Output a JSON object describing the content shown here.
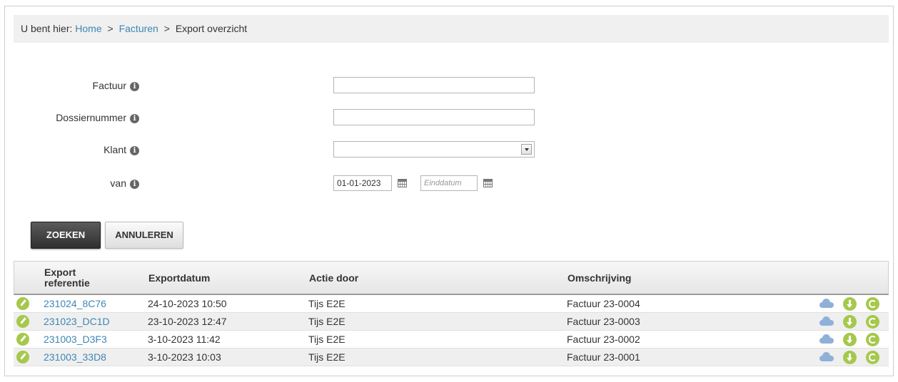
{
  "breadcrumb": {
    "prefix": "U bent hier:",
    "items": [
      "Home",
      "Facturen",
      "Export overzicht"
    ],
    "separator": ">"
  },
  "form": {
    "factuur_label": "Factuur",
    "factuur_value": "",
    "dossier_label": "Dossiernummer",
    "dossier_value": "",
    "klant_label": "Klant",
    "klant_value": "",
    "van_label": "van",
    "start_date": "01-01-2023",
    "end_date_placeholder": "Einddatum"
  },
  "buttons": {
    "search": "ZOEKEN",
    "cancel": "ANNULEREN"
  },
  "table": {
    "headers": {
      "ref_line1": "Export",
      "ref_line2": "referentie",
      "date": "Exportdatum",
      "user": "Actie door",
      "desc": "Omschrijving"
    },
    "rows": [
      {
        "ref": "231024_8C76",
        "date": "24-10-2023 10:50",
        "user": "Tijs E2E",
        "desc": "Factuur 23-0004"
      },
      {
        "ref": "231023_DC1D",
        "date": "23-10-2023 12:47",
        "user": "Tijs E2E",
        "desc": "Factuur 23-0003"
      },
      {
        "ref": "231003_D3F3",
        "date": "3-10-2023 11:42",
        "user": "Tijs E2E",
        "desc": "Factuur 23-0002"
      },
      {
        "ref": "231003_33D8",
        "date": "3-10-2023 10:03",
        "user": "Tijs E2E",
        "desc": "Factuur 23-0001"
      }
    ]
  },
  "icons": {
    "info": "info-icon",
    "calendar": "calendar-icon",
    "edit": "pencil-icon",
    "upload": "cloud-icon",
    "download": "download-icon",
    "refresh": "refresh-icon"
  },
  "colors": {
    "link": "#3f86b5",
    "action_green": "#a6c84c",
    "cloud_blue": "#8fb0d8",
    "primary_button": "#3a3a3a"
  }
}
